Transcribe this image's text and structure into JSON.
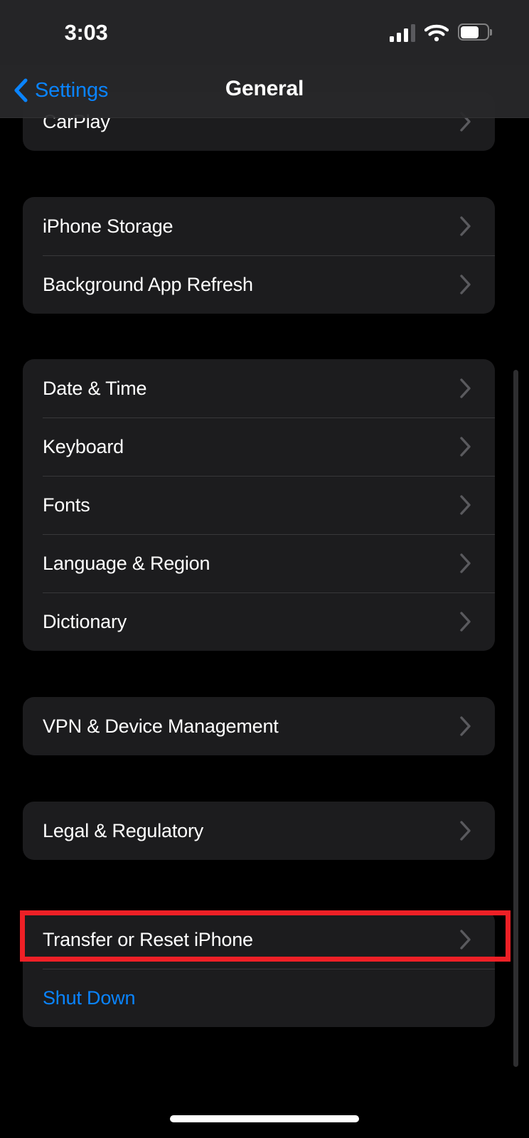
{
  "status_bar": {
    "time": "3:03",
    "cellular_icon": "cellular-bars-icon",
    "cellular_bars_active": 3,
    "cellular_bars_total": 4,
    "wifi_icon": "wifi-icon",
    "battery_icon": "battery-icon",
    "battery_level_percent": 68
  },
  "nav_bar": {
    "back_icon": "chevron-left-icon",
    "back_label": "Settings",
    "title": "General"
  },
  "colors": {
    "accent_blue": "#0A84FF",
    "card_background": "#1C1C1E",
    "page_background": "#000000",
    "separator": "#38383A",
    "chevron": "#5A5A5E",
    "highlight_red": "#EE2026"
  },
  "groups": [
    {
      "name": "carplay-group",
      "rows": [
        {
          "label": "CarPlay",
          "accessory": "chevron-right-icon",
          "style": "default"
        }
      ]
    },
    {
      "name": "storage-group",
      "rows": [
        {
          "label": "iPhone Storage",
          "accessory": "chevron-right-icon",
          "style": "default"
        },
        {
          "label": "Background App Refresh",
          "accessory": "chevron-right-icon",
          "style": "default"
        }
      ]
    },
    {
      "name": "localization-group",
      "rows": [
        {
          "label": "Date & Time",
          "accessory": "chevron-right-icon",
          "style": "default"
        },
        {
          "label": "Keyboard",
          "accessory": "chevron-right-icon",
          "style": "default"
        },
        {
          "label": "Fonts",
          "accessory": "chevron-right-icon",
          "style": "default"
        },
        {
          "label": "Language & Region",
          "accessory": "chevron-right-icon",
          "style": "default"
        },
        {
          "label": "Dictionary",
          "accessory": "chevron-right-icon",
          "style": "default"
        }
      ]
    },
    {
      "name": "vpn-group",
      "rows": [
        {
          "label": "VPN & Device Management",
          "accessory": "chevron-right-icon",
          "style": "default"
        }
      ]
    },
    {
      "name": "legal-group",
      "rows": [
        {
          "label": "Legal & Regulatory",
          "accessory": "chevron-right-icon",
          "style": "default"
        }
      ]
    },
    {
      "name": "reset-group",
      "rows": [
        {
          "label": "Transfer or Reset iPhone",
          "accessory": "chevron-right-icon",
          "style": "default"
        },
        {
          "label": "Shut Down",
          "accessory": "none",
          "style": "accent"
        }
      ]
    }
  ],
  "annotation": {
    "type": "highlight-rectangle",
    "target_label": "Transfer or Reset iPhone",
    "color": "#EE2026"
  },
  "scrollbar": {
    "name": "vertical-scrollbar"
  },
  "home_indicator": {
    "name": "home-indicator"
  }
}
